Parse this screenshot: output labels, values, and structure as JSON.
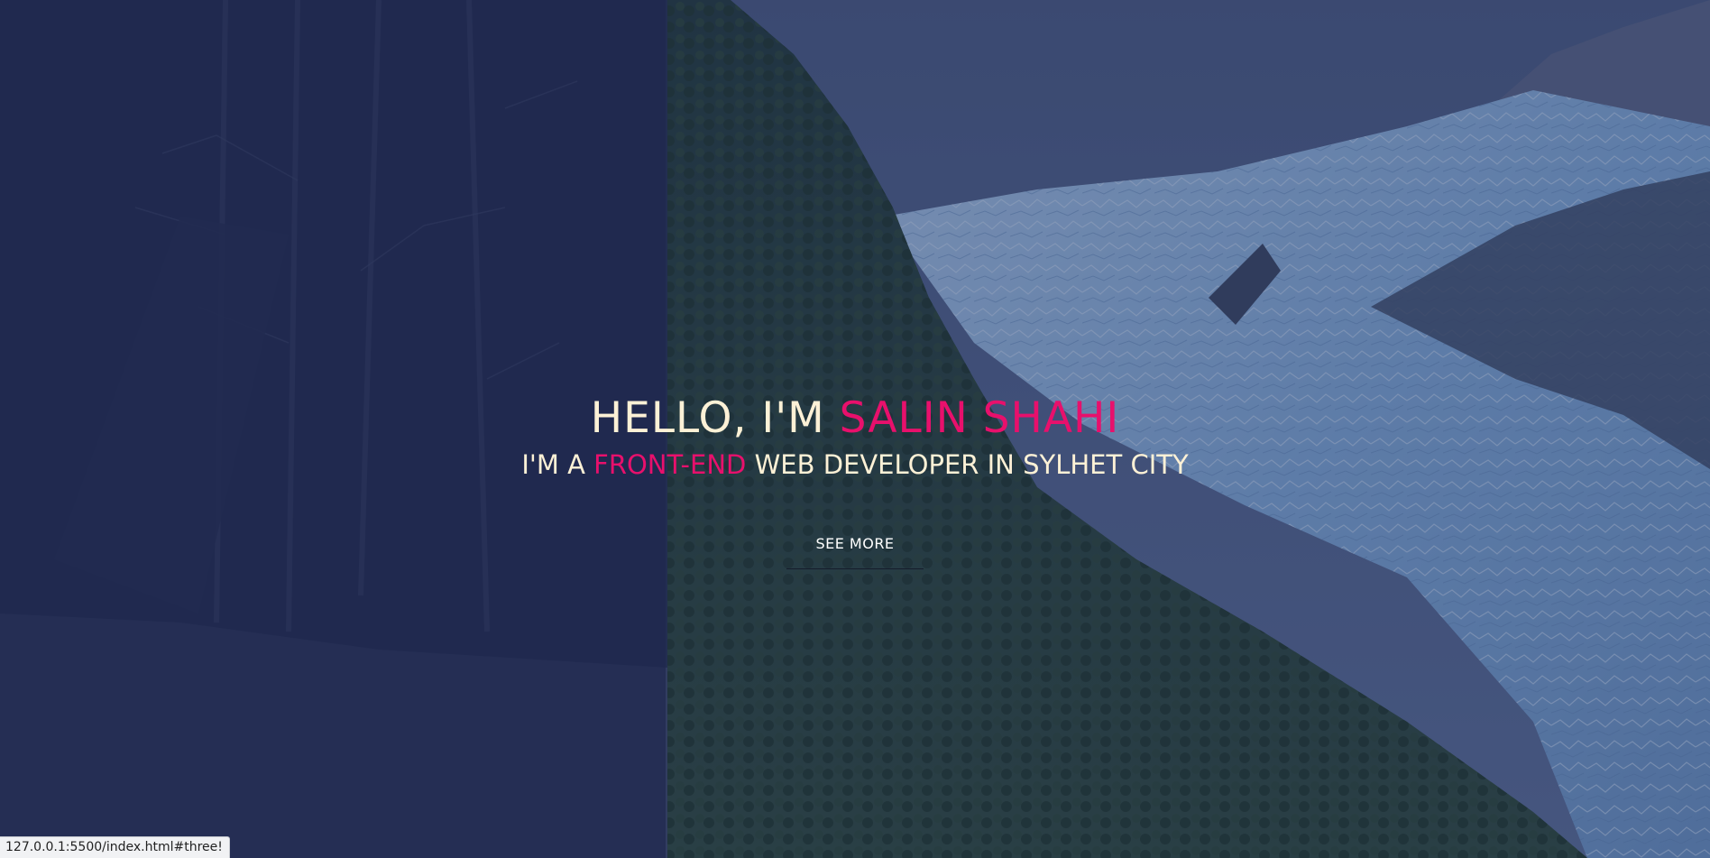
{
  "hero": {
    "headline_prefix": "HELLO, I'M ",
    "headline_name": "SALIN SHAHI",
    "subline_prefix": "I'M A ",
    "subline_accent": "FRONT-END",
    "subline_suffix": " WEB DEVELOPER IN SYLHET CITY",
    "button_label": "SEE MORE",
    "background_image": "mountain-glacier-forest-landscape"
  },
  "status_bar": {
    "url": "127.0.0.1:5500/index.html#three!"
  },
  "colors": {
    "text": "#fdf1d6",
    "accent": "#e8106c",
    "overlay": "#1f2c56"
  }
}
